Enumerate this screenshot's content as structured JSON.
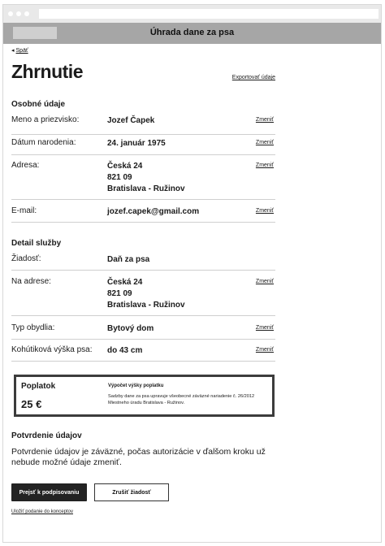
{
  "app": {
    "title": "Úhrada dane za psa"
  },
  "nav": {
    "back_label": "Späť"
  },
  "page": {
    "heading": "Zhrnutie",
    "export_label": "Exportovať údaje"
  },
  "personal": {
    "title": "Osobné údaje",
    "rows": [
      {
        "label": "Meno a priezvisko:",
        "value": [
          "Jozef Čapek"
        ],
        "action": "Zmeniť"
      },
      {
        "label": "Dátum narodenia:",
        "value": [
          "24. január 1975"
        ],
        "action": "Zmeniť"
      },
      {
        "label": "Adresa:",
        "value": [
          "Česká 24",
          "821 09",
          "Bratislava - Ružinov"
        ],
        "action": "Zmeniť"
      },
      {
        "label": "E-mail:",
        "value": [
          "jozef.capek@gmail.com"
        ],
        "action": "Zmeniť"
      }
    ]
  },
  "service": {
    "title": "Detail služby",
    "rows": [
      {
        "label": "Žiadosť:",
        "value": [
          "Daň za psa"
        ],
        "action": ""
      },
      {
        "label": "Na adrese:",
        "value": [
          "Česká 24",
          "821 09",
          "Bratislava - Ružinov"
        ],
        "action": "Zmeniť"
      },
      {
        "label": "Typ obydlia:",
        "value": [
          "Bytový dom"
        ],
        "action": "Zmeniť"
      },
      {
        "label": "Kohútiková výška psa:",
        "value": [
          "do 43 cm"
        ],
        "action": "Zmeniť"
      }
    ]
  },
  "fee": {
    "label": "Poplatok",
    "amount": "25 €",
    "info_title": "Výpočet výšky poplatku",
    "info_text": "Sadzby dane za psa upravuje všeobecné záväzné nariadenie č. 26/2012 Miestneho úradu Bratislava - Ružinov."
  },
  "confirm": {
    "title": "Potvrdenie údajov",
    "text": "Potvrdenie údajov je záväzné, počas autorizácie v ďalšom kroku už nebude možné údaje zmeniť."
  },
  "actions": {
    "primary": "Prejsť k podpisovaniu",
    "secondary": "Zrušiť žiadosť",
    "draft": "Uložiť podanie do konceptov"
  },
  "colors": {
    "appbar": "#a6a6a6",
    "chrome": "#e9e9e9",
    "primary_button": "#232323"
  }
}
